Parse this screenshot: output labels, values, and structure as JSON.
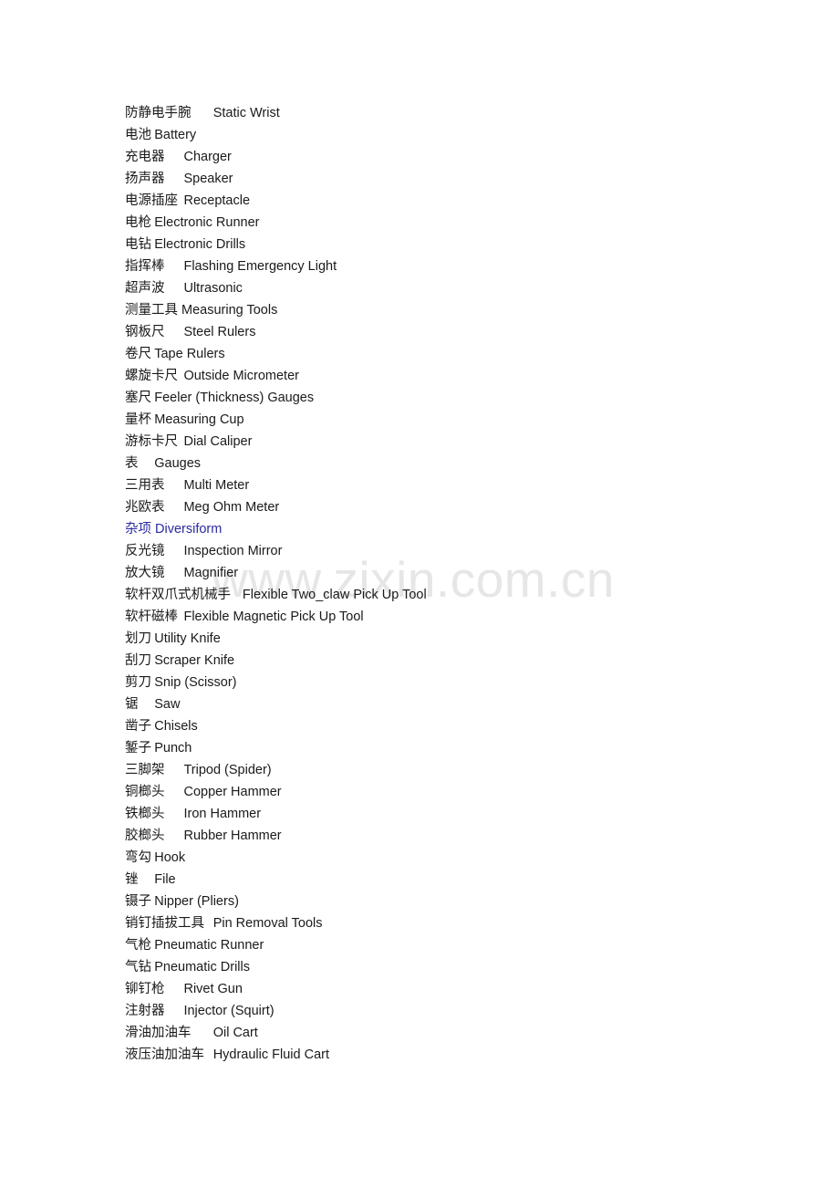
{
  "document": {
    "type": "bilingual-glossary",
    "background_color": "#ffffff",
    "text_color": "#1a1a1a",
    "heading_color": "#2a2aa0",
    "watermark_color": "#e6e6e6"
  },
  "watermark": {
    "text": "www.zixin.com.cn"
  },
  "entries": [
    {
      "zh": "防静电手腕",
      "gap": "\t",
      "en": "Static Wrist",
      "heading": false
    },
    {
      "zh": "电池",
      "gap": "\t",
      "en": "Battery",
      "heading": false
    },
    {
      "zh": "充电器",
      "gap": "\t",
      "en": "Charger",
      "heading": false
    },
    {
      "zh": "扬声器",
      "gap": "\t",
      "en": "Speaker",
      "heading": false
    },
    {
      "zh": "电源插座",
      "gap": "\t",
      "en": "Receptacle",
      "heading": false
    },
    {
      "zh": "电枪",
      "gap": "\t",
      "en": "Electronic Runner",
      "heading": false
    },
    {
      "zh": "电钻",
      "gap": "\t",
      "en": "Electronic Drills",
      "heading": false
    },
    {
      "zh": "指挥棒",
      "gap": "\t",
      "en": "Flashing Emergency Light",
      "heading": false
    },
    {
      "zh": "超声波",
      "gap": "\t",
      "en": "Ultrasonic",
      "heading": false
    },
    {
      "zh": "测量工具",
      "gap": " ",
      "en": "Measuring Tools",
      "heading": false
    },
    {
      "zh": "钢板尺",
      "gap": "\t",
      "en": "Steel Rulers",
      "heading": false
    },
    {
      "zh": "卷尺",
      "gap": "\t",
      "en": "Tape Rulers",
      "heading": false
    },
    {
      "zh": "螺旋卡尺",
      "gap": "\t",
      "en": "Outside Micrometer",
      "heading": false
    },
    {
      "zh": "塞尺",
      "gap": "\t",
      "en": "Feeler (Thickness) Gauges",
      "heading": false
    },
    {
      "zh": "量杯",
      "gap": "\t",
      "en": "Measuring Cup",
      "heading": false
    },
    {
      "zh": "游标卡尺",
      "gap": "\t",
      "en": "Dial Caliper",
      "heading": false
    },
    {
      "zh": "表",
      "gap": "\t",
      "en": "Gauges",
      "heading": false
    },
    {
      "zh": "三用表",
      "gap": "\t",
      "en": "Multi Meter",
      "heading": false
    },
    {
      "zh": "兆欧表",
      "gap": "\t",
      "en": "Meg Ohm Meter",
      "heading": false
    },
    {
      "zh": "杂项",
      "gap": " ",
      "en": "Diversiform",
      "heading": true
    },
    {
      "zh": "反光镜",
      "gap": "\t",
      "en": "Inspection Mirror",
      "heading": false
    },
    {
      "zh": "放大镜",
      "gap": "\t",
      "en": "Magnifier",
      "heading": false
    },
    {
      "zh": "软杆双爪式机械手",
      "gap": "\t",
      "en": "Flexible Two_claw Pick Up Tool",
      "heading": false
    },
    {
      "zh": "软杆磁棒",
      "gap": "\t",
      "en": "Flexible Magnetic Pick Up Tool",
      "heading": false
    },
    {
      "zh": "划刀",
      "gap": "\t",
      "en": "Utility Knife",
      "heading": false
    },
    {
      "zh": "刮刀",
      "gap": "\t",
      "en": "Scraper Knife",
      "heading": false
    },
    {
      "zh": "剪刀",
      "gap": "\t",
      "en": "Snip (Scissor)",
      "heading": false
    },
    {
      "zh": "锯",
      "gap": "\t",
      "en": "Saw",
      "heading": false
    },
    {
      "zh": "凿子",
      "gap": "\t",
      "en": "Chisels",
      "heading": false
    },
    {
      "zh": "錾子",
      "gap": "\t",
      "en": "Punch",
      "heading": false
    },
    {
      "zh": "三脚架",
      "gap": "\t",
      "en": "Tripod (Spider)",
      "heading": false
    },
    {
      "zh": "铜榔头",
      "gap": "\t",
      "en": "Copper Hammer",
      "heading": false
    },
    {
      "zh": "铁榔头",
      "gap": "\t",
      "en": "Iron Hammer",
      "heading": false
    },
    {
      "zh": "胶榔头",
      "gap": "\t",
      "en": "Rubber Hammer",
      "heading": false
    },
    {
      "zh": "弯勾",
      "gap": "\t",
      "en": "Hook",
      "heading": false
    },
    {
      "zh": "锉",
      "gap": "\t",
      "en": "File",
      "heading": false
    },
    {
      "zh": "镊子",
      "gap": "\t",
      "en": "Nipper (Pliers)",
      "heading": false
    },
    {
      "zh": "销钉插拔工具",
      "gap": "\t",
      "en": "Pin Removal Tools",
      "heading": false
    },
    {
      "zh": "气枪",
      "gap": "\t",
      "en": "Pneumatic Runner",
      "heading": false
    },
    {
      "zh": "气钻",
      "gap": "\t",
      "en": "Pneumatic Drills",
      "heading": false
    },
    {
      "zh": "铆钉枪",
      "gap": "\t",
      "en": "Rivet Gun",
      "heading": false
    },
    {
      "zh": "注射器",
      "gap": "\t",
      "en": "Injector (Squirt)",
      "heading": false
    },
    {
      "zh": "滑油加油车",
      "gap": "\t",
      "en": "Oil Cart",
      "heading": false
    },
    {
      "zh": "液压油加油车",
      "gap": "\t",
      "en": "Hydraulic Fluid Cart",
      "heading": false
    }
  ]
}
